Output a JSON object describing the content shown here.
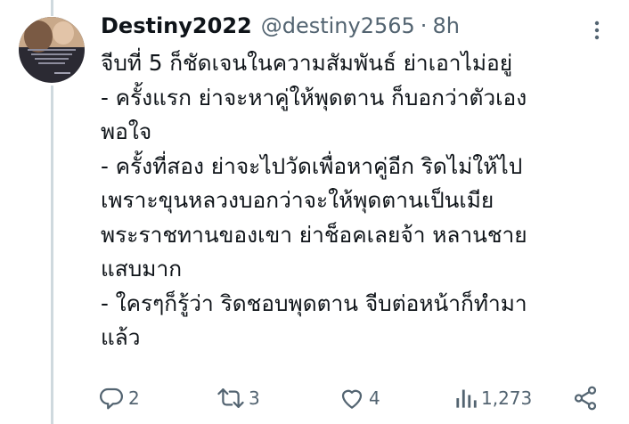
{
  "tweet": {
    "display_name": "Destiny2022",
    "handle": "@destiny2565",
    "separator": "·",
    "time": "8h",
    "text_lines": [
      "จีบที่ 5 ก็ชัดเจนในความสัมพันธ์ ย่าเอาไม่อยู่",
      "- ครั้งแรก ย่าจะหาคู่ให้พุดตาน ก็บอกว่าตัวเอง",
      "พอใจ",
      "- ครั้งที่สอง ย่าจะไปวัดเพื่อหาคู่อีก ริดไม่ให้ไป",
      "เพราะขุนหลวงบอกว่าจะให้พุดตานเป็นเมีย",
      "พระราชทานของเขา ย่าช็อคเลยจ้า หลานชาย",
      "แสบมาก",
      "- ใครๆก็รู้ว่า ริดชอบพุดตาน จีบต่อหน้าก็ทำมา",
      "แล้ว"
    ]
  },
  "actions": {
    "reply_count": "2",
    "retweet_count": "3",
    "like_count": "4",
    "views_count": "1,273"
  },
  "icons": {
    "more": "more-vertical-icon",
    "reply": "reply-icon",
    "retweet": "retweet-icon",
    "like": "heart-icon",
    "views": "views-icon",
    "share": "share-icon"
  },
  "colors": {
    "text": "#0f1419",
    "secondary": "#536471",
    "thread_line": "#cfd9de"
  }
}
